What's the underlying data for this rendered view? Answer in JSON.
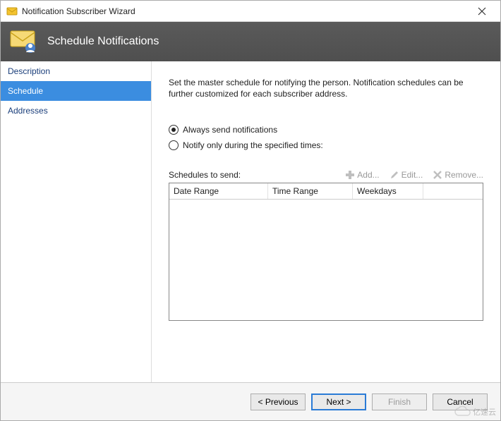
{
  "window": {
    "title": "Notification Subscriber Wizard"
  },
  "header": {
    "title": "Schedule Notifications"
  },
  "sidebar": {
    "items": [
      {
        "label": "Description"
      },
      {
        "label": "Schedule"
      },
      {
        "label": "Addresses"
      }
    ]
  },
  "content": {
    "intro": "Set the master schedule for notifying the person. Notification schedules can be further customized for each subscriber address.",
    "radio_always": "Always send notifications",
    "radio_specified": "Notify only during the specified times:",
    "schedules_label": "Schedules to send:",
    "toolbar": {
      "add": "Add...",
      "edit": "Edit...",
      "remove": "Remove..."
    },
    "columns": {
      "date_range": "Date Range",
      "time_range": "Time Range",
      "weekdays": "Weekdays"
    }
  },
  "footer": {
    "previous": "< Previous",
    "next": "Next >",
    "finish": "Finish",
    "cancel": "Cancel"
  },
  "watermark": "亿速云"
}
